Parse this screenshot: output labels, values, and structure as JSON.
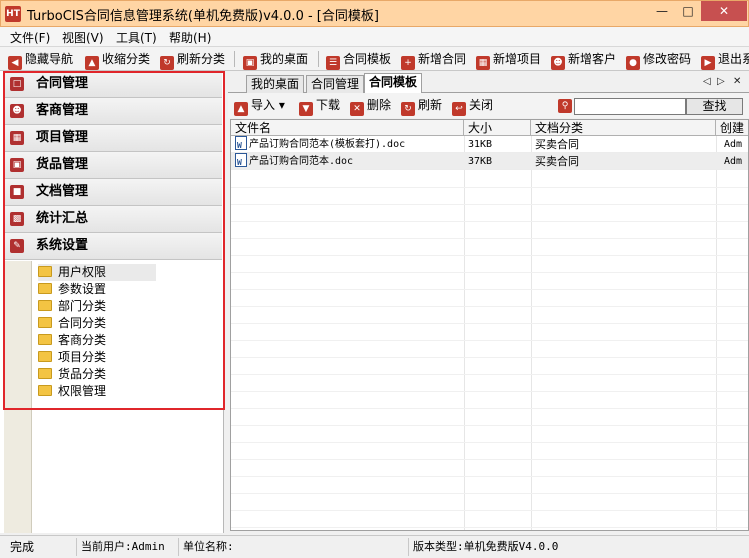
{
  "window": {
    "title": "TurboCIS合同信息管理系统(单机免费版)v4.0.0 - [合同模板]",
    "icon_text": "HT"
  },
  "menu": [
    "文件(F)",
    "视图(V)",
    "工具(T)",
    "帮助(H)"
  ],
  "toolbar": [
    {
      "label": "隐藏导航",
      "icon": "arrow-left-icon"
    },
    {
      "label": "收缩分类",
      "icon": "arrow-up-icon"
    },
    {
      "label": "刷新分类",
      "icon": "refresh-icon"
    },
    {
      "label": "我的桌面",
      "icon": "desktop-icon"
    },
    {
      "label": "合同模板",
      "icon": "template-icon"
    },
    {
      "label": "新增合同",
      "icon": "new-contract-icon"
    },
    {
      "label": "新增项目",
      "icon": "new-project-icon"
    },
    {
      "label": "新增客户",
      "icon": "new-customer-icon"
    },
    {
      "label": "修改密码",
      "icon": "lock-icon"
    },
    {
      "label": "退出系",
      "icon": "exit-icon"
    }
  ],
  "nav": {
    "sections": [
      {
        "label": "合同管理",
        "icon": "contract-icon"
      },
      {
        "label": "客商管理",
        "icon": "people-icon"
      },
      {
        "label": "项目管理",
        "icon": "building-icon"
      },
      {
        "label": "货品管理",
        "icon": "goods-icon"
      },
      {
        "label": "文档管理",
        "icon": "folder-icon"
      },
      {
        "label": "统计汇总",
        "icon": "bar-chart-icon"
      },
      {
        "label": "系统设置",
        "icon": "wrench-icon"
      }
    ],
    "tree": [
      "用户权限",
      "参数设置",
      "部门分类",
      "合同分类",
      "客商分类",
      "项目分类",
      "货品分类",
      "权限管理"
    ],
    "selected_tree": "用户权限"
  },
  "tabs": [
    "我的桌面",
    "合同管理",
    "合同模板"
  ],
  "active_tab": "合同模板",
  "sub_toolbar": [
    {
      "label": "导入",
      "icon": "import-icon"
    },
    {
      "label": "下载",
      "icon": "download-icon"
    },
    {
      "label": "删除",
      "icon": "delete-icon"
    },
    {
      "label": "刷新",
      "icon": "refresh-icon"
    },
    {
      "label": "关闭",
      "icon": "close-icon"
    }
  ],
  "search": {
    "value": "",
    "button": "查找"
  },
  "grid": {
    "columns": [
      "文件名",
      "大小",
      "文档分类",
      "创建"
    ],
    "rows": [
      {
        "name": "产品订购合同范本(模板套打).doc",
        "size": "31KB",
        "category": "买卖合同",
        "creator": "Adm"
      },
      {
        "name": "产品订购合同范本.doc",
        "size": "37KB",
        "category": "买卖合同",
        "creator": "Adm"
      }
    ]
  },
  "status": {
    "state": "完成",
    "user": "当前用户:Admin",
    "unit": "单位名称:",
    "version": "版本类型:单机免费版V4.0.0"
  },
  "colors": {
    "accent": "#c0392b",
    "titlebar": "#ffd5a4",
    "highlight": "#e0262b",
    "close": "#c75050"
  }
}
